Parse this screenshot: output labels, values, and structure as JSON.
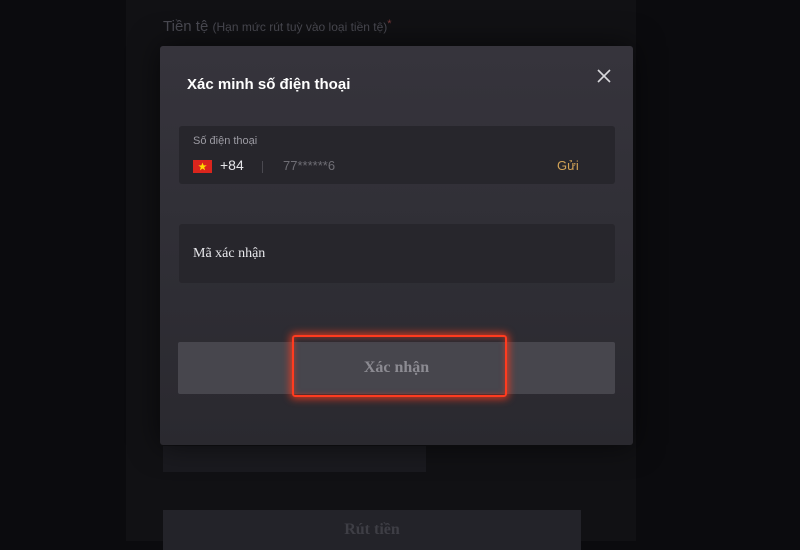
{
  "background": {
    "currency_label": "Tiền tệ",
    "currency_hint": "(Hạn mức rút tuỳ vào loại tiền tệ)",
    "required_mark": "*",
    "submit_label": "Rút tiền"
  },
  "modal": {
    "title": "Xác minh số điện thoại",
    "close_icon": "close-icon",
    "phone": {
      "label": "Số điện thoại",
      "flag_icon": "vietnam-flag-icon",
      "country_code": "+84",
      "value": "77******6",
      "send_label": "Gửi"
    },
    "code": {
      "placeholder": "Mã xác nhận"
    },
    "confirm_label": "Xác nhận"
  },
  "colors": {
    "accent_send": "#d1a256",
    "highlight": "#ff3b1f"
  }
}
